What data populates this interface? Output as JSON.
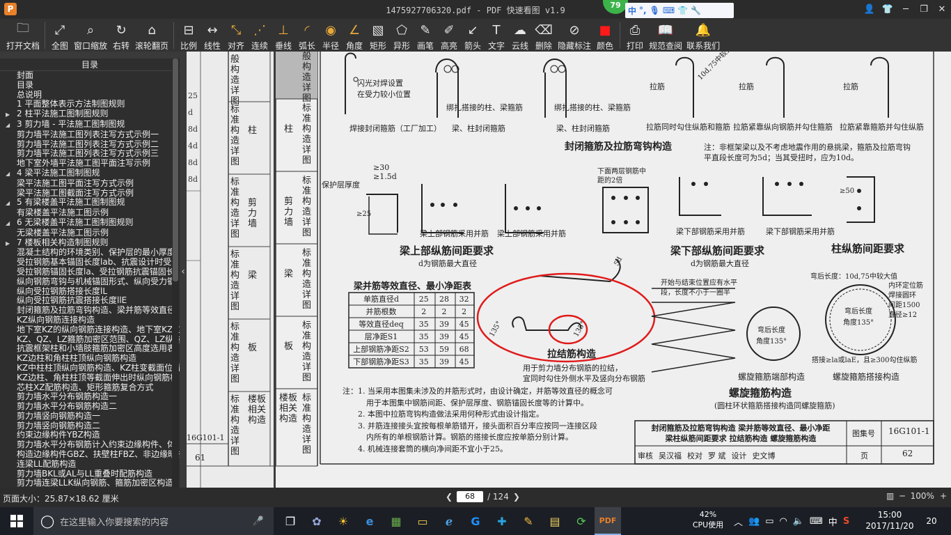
{
  "titlebar": {
    "logo": "P",
    "title": "1475927706320.pdf - PDF 快速看图 v1.9",
    "ime_badge": "79",
    "ime_lang": "中"
  },
  "toolbar": {
    "items": [
      {
        "label": "打开文档",
        "icon": "folder-icon"
      },
      {
        "label": "全图",
        "icon": "fit-all-icon"
      },
      {
        "label": "窗口缩放",
        "icon": "zoom-window-icon"
      },
      {
        "label": "右转",
        "icon": "rotate-right-icon"
      },
      {
        "label": "滚轮翻页",
        "icon": "mouse-wheel-icon"
      },
      {
        "label": "比例",
        "icon": "scale-icon"
      },
      {
        "label": "线性",
        "icon": "linear-measure-icon"
      },
      {
        "label": "对齐",
        "icon": "aligned-measure-icon"
      },
      {
        "label": "连续",
        "icon": "continuous-measure-icon"
      },
      {
        "label": "垂线",
        "icon": "perpendicular-icon"
      },
      {
        "label": "弧长",
        "icon": "arc-length-icon"
      },
      {
        "label": "半径",
        "icon": "radius-icon"
      },
      {
        "label": "角度",
        "icon": "angle-icon"
      },
      {
        "label": "矩形",
        "icon": "rectangle-icon"
      },
      {
        "label": "异形",
        "icon": "polygon-icon"
      },
      {
        "label": "画笔",
        "icon": "pen-icon"
      },
      {
        "label": "高亮",
        "icon": "highlighter-icon"
      },
      {
        "label": "箭头",
        "icon": "arrow-icon"
      },
      {
        "label": "文字",
        "icon": "text-icon"
      },
      {
        "label": "云线",
        "icon": "cloud-icon"
      },
      {
        "label": "删除",
        "icon": "eraser-icon"
      },
      {
        "label": "隐藏标注",
        "icon": "hide-eye-icon"
      },
      {
        "label": "颜色",
        "icon": "color-swatch-icon"
      },
      {
        "label": "打印",
        "icon": "printer-icon"
      },
      {
        "label": "规范查阅",
        "icon": "book-icon"
      },
      {
        "label": "联系我们",
        "icon": "contact-icon"
      }
    ]
  },
  "sidebar": {
    "header": "目录",
    "items": [
      {
        "level": "l0",
        "label": "封面"
      },
      {
        "level": "l0",
        "label": "目录"
      },
      {
        "level": "l0",
        "label": "总说明"
      },
      {
        "level": "l2",
        "label": "1 平面整体表示方法制图规则"
      },
      {
        "level": "l1",
        "label": "2 柱平法施工图制图规则",
        "expander": "▶"
      },
      {
        "level": "l1",
        "label": "3 剪力墙 - 平法施工图制图规",
        "expander": "◢"
      },
      {
        "level": "l0",
        "label": "剪力墙平法施工图列表注写方式示例一"
      },
      {
        "level": "l0",
        "label": "剪力墙平法施工图列表注写方式示例二"
      },
      {
        "level": "l0",
        "label": "剪力墙平法施工图列表注写方式示例三"
      },
      {
        "level": "l0",
        "label": "地下室外墙平法施工图平面注写示例"
      },
      {
        "level": "l1",
        "label": "4 梁平法施工图制图规",
        "expander": "◢"
      },
      {
        "level": "l0",
        "label": "梁平法施工图平面注写方式示例"
      },
      {
        "level": "l0",
        "label": "梁平法施工图截面注写方式示例"
      },
      {
        "level": "l1",
        "label": "5 有梁楼盖平法施工图制图规",
        "expander": "◢"
      },
      {
        "level": "l0",
        "label": "有梁楼盖平法施工图示例"
      },
      {
        "level": "l1",
        "label": "6 无梁楼盖平法施工图制图规则",
        "expander": "◢"
      },
      {
        "level": "l0",
        "label": "无梁楼盖平法施工图示例"
      },
      {
        "level": "l1",
        "label": "7 楼板相关构造制图规则",
        "expander": "▶"
      },
      {
        "level": "l0",
        "label": "混凝土结构的环境类别、保护层的最小厚度"
      },
      {
        "level": "l0",
        "label": "受拉钢筋基本锚固长度lab、抗震设计时受"
      },
      {
        "level": "l0",
        "label": "受拉钢筋锚固长度la、受拉钢筋抗震锚固长"
      },
      {
        "level": "l0",
        "label": "纵向钢筋弯钩与机械锚固形式、纵向受力钢"
      },
      {
        "level": "l0",
        "label": "纵向受拉钢筋搭接长度lL"
      },
      {
        "level": "l0",
        "label": "纵向受拉钢筋抗震搭接长度llE"
      },
      {
        "level": "l0",
        "label": "封闭箍筋及拉筋弯钩构造、梁并筋等效直径"
      },
      {
        "level": "l0",
        "label": "KZ纵向钢筋连接构造"
      },
      {
        "level": "l0",
        "label": "地下室KZ的纵向钢筋连接构造、地下室KZ的"
      },
      {
        "level": "l0",
        "label": "KZ、QZ、LZ箍筋加密区范围、QZ、LZ纵向钢"
      },
      {
        "level": "l0",
        "label": "抗震框架柱和小墙肢箍筋加密区高度选用表"
      },
      {
        "level": "l0",
        "label": "KZ边柱和角柱柱顶纵向钢筋构造"
      },
      {
        "level": "l0",
        "label": "KZ中柱柱顶纵向钢筋构造、KZ柱变截面位置"
      },
      {
        "level": "l0",
        "label": "KZ边柱、角柱柱顶等截面伸出时纵向钢筋构"
      },
      {
        "level": "l0",
        "label": "芯柱XZ配筋构造、矩形箍筋复合方式"
      },
      {
        "level": "l0",
        "label": "剪力墙水平分布钢筋构造一"
      },
      {
        "level": "l0",
        "label": "剪力墙水平分布钢筋构造二"
      },
      {
        "level": "l0",
        "label": "剪力墙竖向钢筋构造一"
      },
      {
        "level": "l0",
        "label": "剪力墙竖向钢筋构造二"
      },
      {
        "level": "l0",
        "label": "约束边缘构件YBZ构造"
      },
      {
        "level": "l0",
        "label": "剪力墙水平分布钢筋计入约束边缘构件、体"
      },
      {
        "level": "l0",
        "label": "构造边缘构件GBZ、扶壁柱FBZ、非边缘暗柱"
      },
      {
        "level": "l0",
        "label": "连梁LL配筋构造"
      },
      {
        "level": "l0",
        "label": "剪力墙BKL或AL与LL重叠时配筋构造"
      },
      {
        "level": "l0",
        "label": "剪力墙连梁LLK纵向钢筋、箍筋加密区构造"
      }
    ]
  },
  "document": {
    "left_page": {
      "chars": [
        "般构造详图",
        "标准构造详图",
        "标准构造详图",
        "标准构造详图",
        "标准构造详图",
        "标准构造详图"
      ],
      "labels": [
        "柱",
        "剪力墙",
        "梁",
        "板",
        "楼板相关构造"
      ],
      "code": "16G101-1",
      "page_no": "61",
      "edge_marks": [
        "25",
        "d",
        "8d",
        "4d",
        "8d",
        "8d"
      ]
    },
    "main_page": {
      "side_tabs": [
        {
          "cat": "",
          "std": "般构造详图"
        },
        {
          "cat": "柱",
          "std": "标准构造详图"
        },
        {
          "cat": "剪力墙",
          "std": "标准构造详图"
        },
        {
          "cat": "梁",
          "std": "标准构造详图"
        },
        {
          "cat": "板",
          "std": "标准构造详图"
        },
        {
          "cat": "楼板相关构造",
          "std": "标准构造详图"
        }
      ],
      "top_notes": {
        "n1": "闪光对焊设置",
        "n2": "在受力较小位置",
        "n3": "焊接封闭箍筋（工厂加工）",
        "n4": "绑扎搭接的柱、梁箍筋",
        "n5": "梁、柱封闭箍筋",
        "n6": "拉筋同时勾住纵筋和箍筋",
        "n7": "拉筋紧靠纵向钢筋并勾住箍筋",
        "n8": "拉筋紧靠箍筋并勾住纵筋",
        "hook": "10d,75中较大值",
        "tie": "拉筋"
      },
      "section_titles": {
        "closed_stirrup": "封闭箍筋及拉筋弯钩构造",
        "beam_top": "梁上部纵筋间距要求",
        "beam_bottom": "梁下部纵筋间距要求",
        "column": "柱纵筋间距要求",
        "bundle_table": "梁并筋等效直径、最小净距表",
        "tie_bar": "拉结筋构造",
        "spiral": "螺旋箍筋构造"
      },
      "note_right": "注：非框架梁以及不考虑地震作用的悬挑梁，箍筋及拉筋弯钩平直段长度可为5d；当其受扭时，应为10d。",
      "beam_notes": {
        "cover": "保护层厚度",
        "top_single": "梁上部钢筋采用并筋",
        "top_double": "梁上部钢筋采用并筋",
        "bottom_single": "梁下部钢筋采用并筋",
        "bottom_double": "梁下部钢筋采用并筋",
        "lower_two": "下面两层钢筋中距的2倍",
        "d_is": "d为钢筋最大直径",
        "d_is2": "d为钢筋最大直径",
        "cond1": "≥30",
        "cond2": "≥1.5d",
        "cond3": "≥25",
        "cond4": "≥50"
      },
      "table": {
        "rows": [
          {
            "label": "单筋直径d",
            "v": [
              "25",
              "28",
              "32"
            ]
          },
          {
            "label": "并筋根数",
            "v": [
              "2",
              "2",
              "2"
            ]
          },
          {
            "label": "等效直径deq",
            "v": [
              "35",
              "39",
              "45"
            ]
          },
          {
            "label": "层净距S1",
            "v": [
              "35",
              "39",
              "45"
            ]
          },
          {
            "label": "上部钢筋净距S2",
            "v": [
              "53",
              "59",
              "68"
            ]
          },
          {
            "label": "下部钢筋净距S3",
            "v": [
              "35",
              "39",
              "45"
            ]
          }
        ]
      },
      "tie_notes": {
        "t1": "用于剪力墙分布钢筋的拉结，",
        "t2": "宜同时勾住外侧水平及竖向分布钢筋",
        "angle": "135°",
        "hook5d": "5d"
      },
      "spiral_notes": {
        "s1": "开始与结束位置应有水平",
        "s2": "段，长度不小于一圈半",
        "s3": "弯后长度",
        "s4": "角度135°",
        "s5": "螺旋箍筋端部构造",
        "s6": "搭接≥lа或laE，且≥300勾住纵筋",
        "s7": "螺旋箍筋搭接构造",
        "s8": "弯后长度：10d,75中较大值",
        "s9": "内环定位筋",
        "s10": "焊接圆环",
        "s11": "间距1500",
        "s12": "直径≥12",
        "s13": "(圆柱环状箍筋搭接构造同螺旋箍筋)"
      },
      "footnotes": [
        "注：1. 当采用本图集未涉及的并筋形式时，由设计确定，并筋等效直径的概念可",
        "用于本图集中钢筋间距、保护层厚度、钢筋锚固长度等的计算中。",
        "2. 本图中拉筋弯钩构造做法采用何种形式由设计指定。",
        "3. 并筋连接接头宜按每根单筋错开，接头面积百分率应按同一连接区段",
        "内所有的单根钢筋计算。钢筋的搭接长度应按单筋分别计算。",
        "4. 机械连接套筒的横向净间距不宜小于25。"
      ],
      "title_block": {
        "line1": "封闭箍筋及拉筋弯钩构造  梁并筋等效直径、最小净距",
        "line2": "梁柱纵筋间距要求  拉结筋构造  螺旋箍筋构造",
        "atlas_label": "图集号",
        "atlas_no": "16G101-1",
        "review": "审核",
        "reviewer": "吴汉福",
        "check": "校对",
        "checker": "罗 斌",
        "design": "设计",
        "designer": "史文博",
        "page_label": "页",
        "page_no": "62"
      }
    }
  },
  "statusbar": {
    "page_size": "页面大小：25.87×18.62 厘米",
    "current_page": "68",
    "total_pages": "/ 124",
    "zoom": "100%"
  },
  "taskbar": {
    "search_placeholder": "在这里输入你要搜索的内容",
    "cpu_pct": "42%",
    "cpu_label": "CPU使用",
    "lang": "中",
    "time": "15:00",
    "date": "2017/11/20",
    "notif_count": "20"
  }
}
